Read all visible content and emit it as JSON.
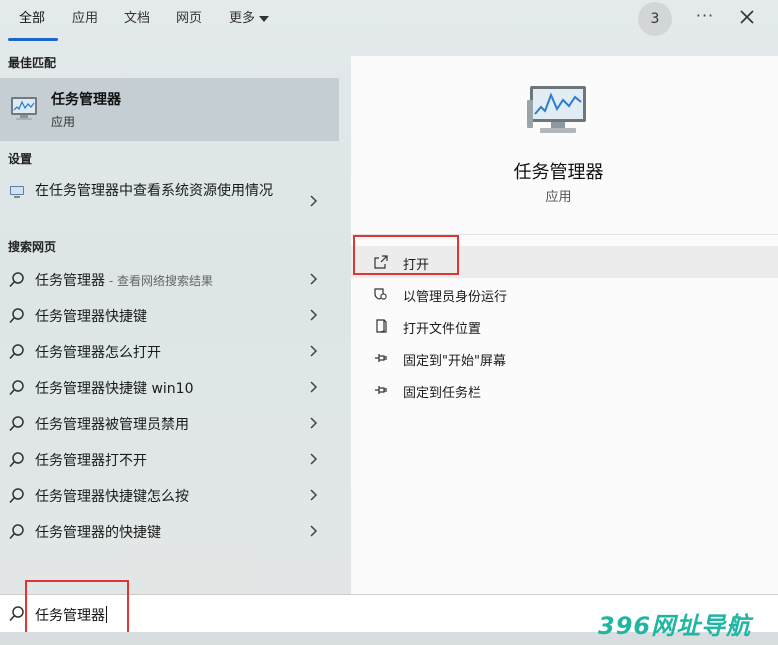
{
  "tabs": [
    {
      "label": "全部"
    },
    {
      "label": "应用"
    },
    {
      "label": "文档"
    },
    {
      "label": "网页"
    },
    {
      "label": "更多"
    }
  ],
  "badge": "3",
  "more_glyph": "···",
  "sections": {
    "best": "最佳匹配",
    "settings": "设置",
    "web": "搜索网页"
  },
  "best_match": {
    "name": "任务管理器",
    "type": "应用"
  },
  "setting_item": {
    "label": "在任务管理器中查看系统资源使用情况"
  },
  "web_results": [
    {
      "label": "任务管理器",
      "hint": " - 查看网络搜索结果"
    },
    {
      "label": "任务管理器快捷键",
      "hint": ""
    },
    {
      "label": "任务管理器怎么打开",
      "hint": ""
    },
    {
      "label": "任务管理器快捷键 win10",
      "hint": ""
    },
    {
      "label": "任务管理器被管理员禁用",
      "hint": ""
    },
    {
      "label": "任务管理器打不开",
      "hint": ""
    },
    {
      "label": "任务管理器快捷键怎么按",
      "hint": ""
    },
    {
      "label": "任务管理器的快捷键",
      "hint": ""
    }
  ],
  "detail": {
    "title": "任务管理器",
    "subtitle": "应用",
    "actions": [
      {
        "label": "打开"
      },
      {
        "label": "以管理员身份运行"
      },
      {
        "label": "打开文件位置"
      },
      {
        "label": "固定到\"开始\"屏幕"
      },
      {
        "label": "固定到任务栏"
      }
    ]
  },
  "search": {
    "value": "任务管理器"
  },
  "watermark": "396网址导航",
  "colors": {
    "accent": "#1b66c9",
    "highlight_box": "#e03535",
    "watermark": "#21b5a4"
  }
}
